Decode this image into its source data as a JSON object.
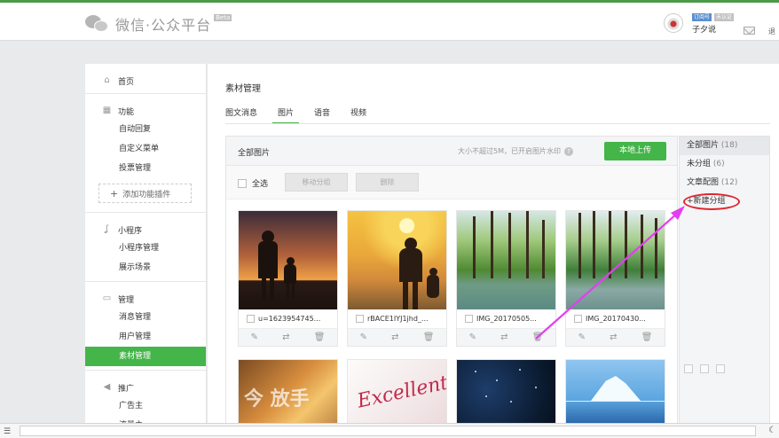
{
  "header": {
    "title": "微信·公众平台",
    "beta": "Beta",
    "badge_type": "订阅号",
    "badge_status": "未认证",
    "username": "子夕说",
    "exit": "退"
  },
  "sidebar": {
    "home": "首页",
    "function": {
      "title": "功能",
      "items": [
        "自动回复",
        "自定义菜单",
        "投票管理"
      ],
      "add_plugin": "添加功能插件"
    },
    "miniprogram": {
      "title": "小程序",
      "items": [
        "小程序管理",
        "展示场景"
      ]
    },
    "manage": {
      "title": "管理",
      "items": [
        "消息管理",
        "用户管理",
        "素材管理"
      ],
      "active": "素材管理"
    },
    "promote": {
      "title": "推广",
      "items": [
        "广告主",
        "流量主"
      ]
    }
  },
  "main": {
    "section_title": "素材管理",
    "tabs": [
      "图文消息",
      "图片",
      "语音",
      "视频"
    ],
    "active_tab": "图片",
    "panel_title": "全部图片",
    "upload_hint": "大小不超过5M，已开启图片水印",
    "upload_button": "本地上传",
    "select_all": "全选",
    "move_group": "移动分组",
    "delete": "删除",
    "images": [
      {
        "name": "u=1623954745..."
      },
      {
        "name": "rBACE1IYJ1jhd_..."
      },
      {
        "name": "IMG_20170505..."
      },
      {
        "name": "IMG_20170430..."
      },
      {
        "name": ""
      },
      {
        "name": ""
      },
      {
        "name": ""
      },
      {
        "name": ""
      }
    ],
    "overlay_texts": {
      "excellent": "Excellent",
      "cn": "今 放手"
    }
  },
  "groups": {
    "items": [
      {
        "label": "全部图片",
        "count": "(18)"
      },
      {
        "label": "未分组",
        "count": "(6)"
      },
      {
        "label": "文章配图",
        "count": "(12)"
      }
    ],
    "new_group": "+新建分组"
  },
  "colors": {
    "accent": "#44b549",
    "annotation_red": "#e0262e",
    "annotation_arrow": "#e33ef0"
  }
}
